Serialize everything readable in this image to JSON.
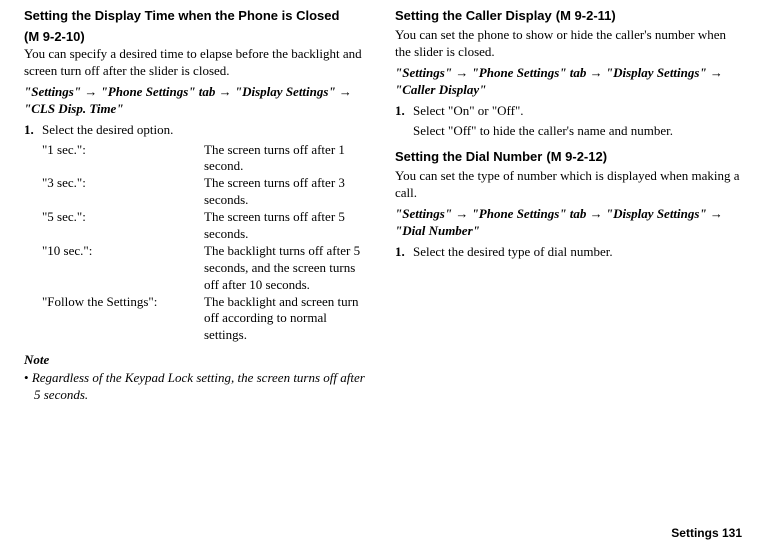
{
  "left": {
    "section1": {
      "title": "Setting the Display Time when the Phone is Closed",
      "mcode": "(M 9-2-10)",
      "intro": "You can specify a desired time to elapse before the backlight and screen turn off after the slider is closed.",
      "path_parts": [
        "\"Settings\"",
        "\"Phone Settings\" tab",
        "\"Display Settings\"",
        "\"CLS Disp. Time\""
      ],
      "step_num": "1.",
      "step_text": "Select the desired option.",
      "options": [
        {
          "key": "\"1 sec.\":",
          "val": "The screen turns off after 1 second."
        },
        {
          "key": "\"3 sec.\":",
          "val": "The screen turns off after 3 seconds."
        },
        {
          "key": "\"5 sec.\":",
          "val": "The screen turns off after 5 seconds."
        },
        {
          "key": "\"10 sec.\":",
          "val": "The backlight turns off after 5 seconds, and the screen turns off after 10 seconds."
        },
        {
          "key": "\"Follow the Settings\":",
          "val": "The backlight and screen turn off according to normal settings."
        }
      ],
      "note_title": "Note",
      "note_body": "Regardless of the Keypad Lock setting, the screen turns off after 5 seconds."
    }
  },
  "right": {
    "section2": {
      "title": "Setting the Caller Display",
      "mcode": "(M 9-2-11)",
      "intro": "You can set the phone to show or hide the caller's number when the slider is closed.",
      "path_parts": [
        "\"Settings\"",
        "\"Phone Settings\" tab",
        "\"Display Settings\"",
        "\"Caller Display\""
      ],
      "step_num": "1.",
      "step_text": "Select \"On\" or \"Off\".",
      "step_sub": "Select \"Off\" to hide the caller's name and number."
    },
    "section3": {
      "title": "Setting the Dial Number",
      "mcode": "(M 9-2-12)",
      "intro": "You can set the type of number which is displayed when making a call.",
      "path_parts": [
        "\"Settings\"",
        "\"Phone Settings\" tab",
        "\"Display Settings\"",
        "\"Dial Number\""
      ],
      "step_num": "1.",
      "step_text": "Select the desired type of dial number."
    }
  },
  "footer": "Settings   131",
  "arrow": "→"
}
